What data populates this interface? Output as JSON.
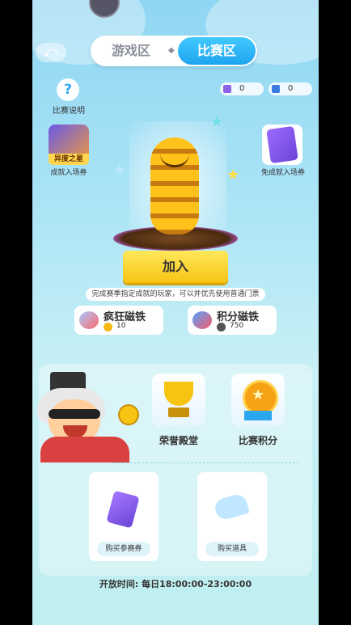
{
  "tabs": {
    "game": "游戏区",
    "match": "比赛区",
    "separator": "◆"
  },
  "help": {
    "icon": "?",
    "label": "比赛说明"
  },
  "counters": [
    {
      "value": "0",
      "icon": "purple-ticket-icon",
      "color": "#8c63e8"
    },
    {
      "value": "0",
      "icon": "blue-ticket-icon",
      "color": "#3a7ce0"
    }
  ],
  "left_item": {
    "badge": "异度之星",
    "label": "成就入场券"
  },
  "right_item": {
    "label": "免成就入场券"
  },
  "join_button": "加入",
  "note": "完成赛季指定成就的玩家，可以并优先使用普通门票",
  "magnets": [
    {
      "name": "疯狂磁铁",
      "amount": "10"
    },
    {
      "name": "积分磁铁",
      "amount": "750"
    }
  ],
  "cards": [
    {
      "label": "荣誉殿堂",
      "icon": "trophy-icon"
    },
    {
      "label": "比赛积分",
      "icon": "medal-icon"
    }
  ],
  "shop": [
    {
      "label": "购买参赛券",
      "icon": "ticket-icon"
    },
    {
      "label": "购买道具",
      "icon": "wing-icon"
    }
  ],
  "open_time": "开放时间: 每日18:00:00-23:00:00",
  "colors": {
    "accent": "#1da4ef",
    "button": "#f7c414",
    "background": "#a9e3f6"
  }
}
